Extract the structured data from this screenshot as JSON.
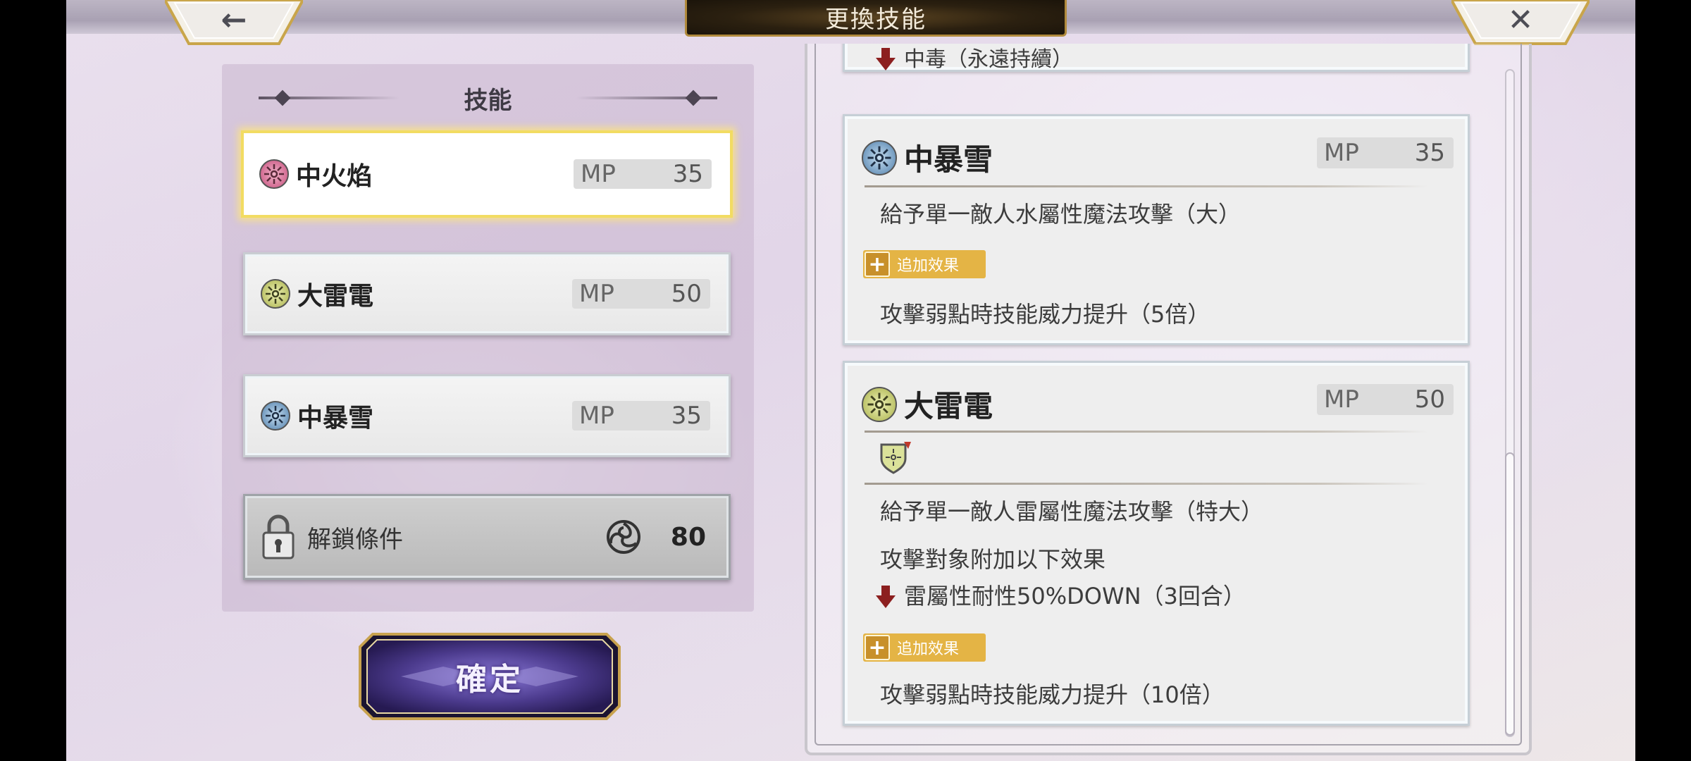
{
  "header": {
    "title": "更換技能",
    "back_icon": "←",
    "close_icon": "✕"
  },
  "skill_list": {
    "heading": "技能",
    "items": [
      {
        "name": "中火焰",
        "element": "fire",
        "mp_label": "MP",
        "mp": "35",
        "selected": true
      },
      {
        "name": "大雷電",
        "element": "thunder",
        "mp_label": "MP",
        "mp": "50",
        "selected": false
      },
      {
        "name": "中暴雪",
        "element": "ice",
        "mp_label": "MP",
        "mp": "35",
        "selected": false
      }
    ],
    "locked": {
      "label": "解鎖條件",
      "cost": "80"
    }
  },
  "confirm_button": {
    "label": "確定"
  },
  "details": {
    "partial_top_text": "中毒（永遠持續）",
    "cards": [
      {
        "name": "中暴雪",
        "element": "ice",
        "mp_label": "MP",
        "mp": "35",
        "description": "給予單一敵人水屬性魔法攻擊（大）",
        "extra_label": "追加效果",
        "extra_text": "攻擊弱點時技能威力提升（5倍）"
      },
      {
        "name": "大雷電",
        "element": "thunder",
        "mp_label": "MP",
        "mp": "50",
        "description": "給予單一敵人雷屬性魔法攻擊（特大）",
        "effect_intro": "攻擊對象附加以下效果",
        "debuff": "雷屬性耐性50%DOWN（3回合）",
        "extra_label": "追加效果",
        "extra_text": "攻擊弱點時技能威力提升（10倍）"
      }
    ]
  },
  "colors": {
    "selected_border": "#f2dc62",
    "badge": "#e4b445",
    "confirm_button": "#4b3a8c",
    "debuff_arrow": "#8c1f1f"
  }
}
